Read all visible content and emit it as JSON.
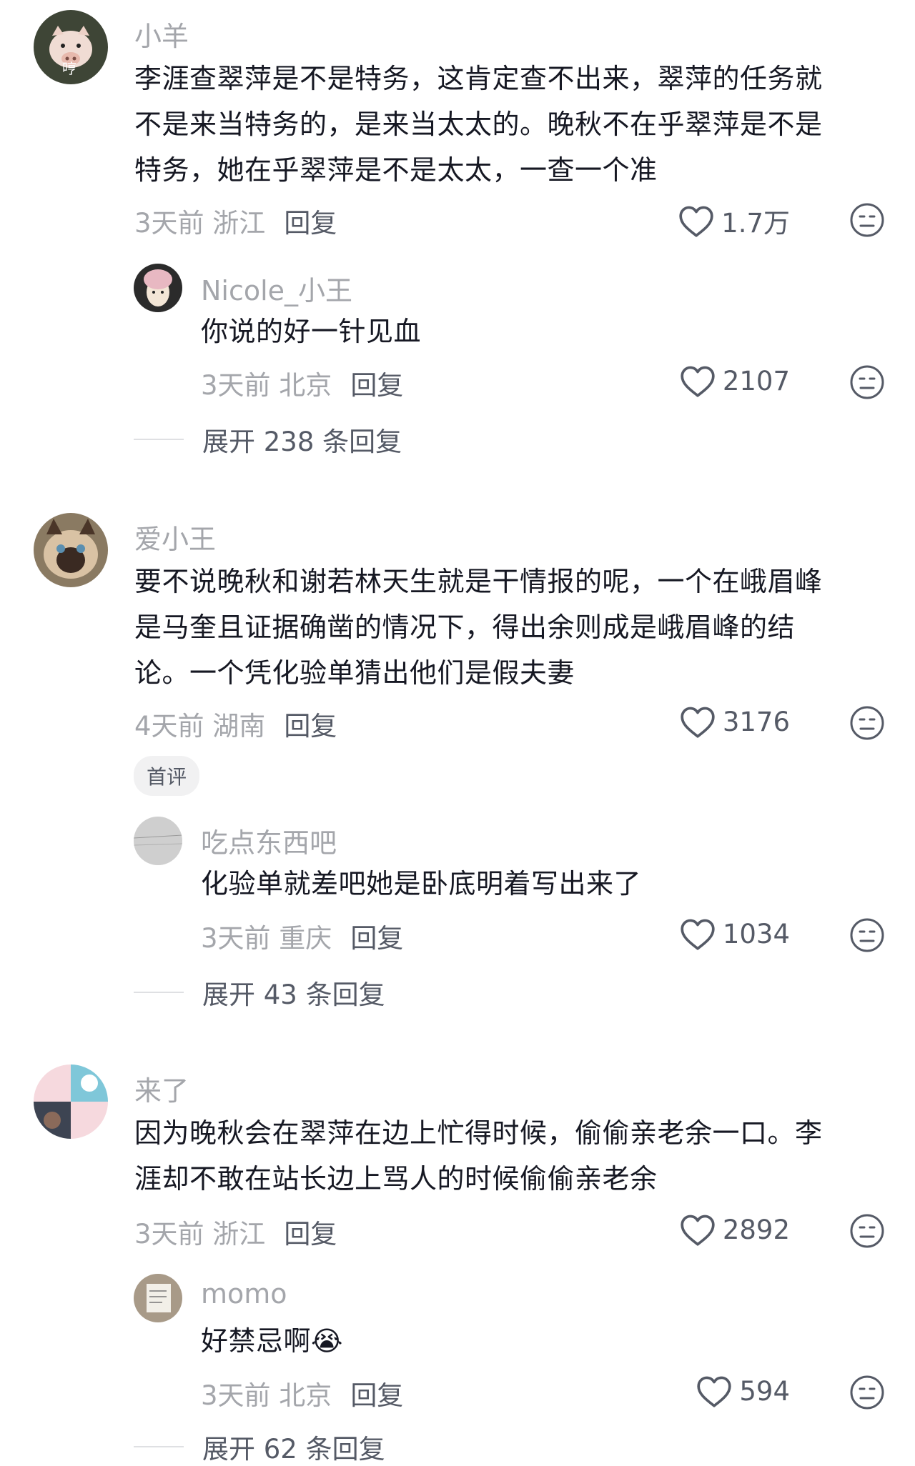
{
  "comments": [
    {
      "username": "小羊",
      "avatar_text": "哼",
      "lines": [
        "李涯查翠萍是不是特务，这肯定查不出来，翠萍的任务就",
        "不是来当特务的，是来当太太的。晚秋不在乎翠萍是不是",
        "特务，她在乎翠萍是不是太太，一查一个准"
      ],
      "time_location": "3天前 浙江",
      "reply_label": "回复",
      "likes": "1.7万",
      "replies": [
        {
          "username": "Nicole_小王",
          "text": "你说的好一针见血",
          "time_location": "3天前 北京",
          "reply_label": "回复",
          "likes": "2107"
        }
      ],
      "expand_label": "展开 238 条回复"
    },
    {
      "username": "爱小王",
      "lines": [
        "要不说晚秋和谢若林天生就是干情报的呢，一个在峨眉峰",
        "是马奎且证据确凿的情况下，得出余则成是峨眉峰的结",
        "论。一个凭化验单猜出他们是假夫妻"
      ],
      "time_location": "4天前 湖南",
      "reply_label": "回复",
      "likes": "3176",
      "badge": "首评",
      "replies": [
        {
          "username": "吃点东西吧",
          "text": "化验单就差吧她是卧底明着写出来了",
          "time_location": "3天前 重庆",
          "reply_label": "回复",
          "likes": "1034"
        }
      ],
      "expand_label": "展开 43 条回复"
    },
    {
      "username": "来了",
      "lines": [
        "因为晚秋会在翠萍在边上忙得时候，偷偷亲老余一口。李",
        "涯却不敢在站长边上骂人的时候偷偷亲老余"
      ],
      "time_location": "3天前 浙江",
      "reply_label": "回复",
      "likes": "2892",
      "replies": [
        {
          "username": "momo",
          "text": "好禁忌啊",
          "emoji": "😭",
          "time_location": "3天前 北京",
          "reply_label": "回复",
          "likes": "594"
        }
      ],
      "expand_label": "展开 62 条回复"
    }
  ],
  "icons": {
    "like": "heart-outline-icon",
    "dislike": "meh-face-icon",
    "reply_avatar_emoji": "crying-face-emoji"
  },
  "colors": {
    "text_primary": "#161823",
    "text_secondary": "#a4a6ab",
    "action": "#555a66",
    "divider": "#dfe0e3",
    "badge_bg": "#f1f1f2"
  }
}
